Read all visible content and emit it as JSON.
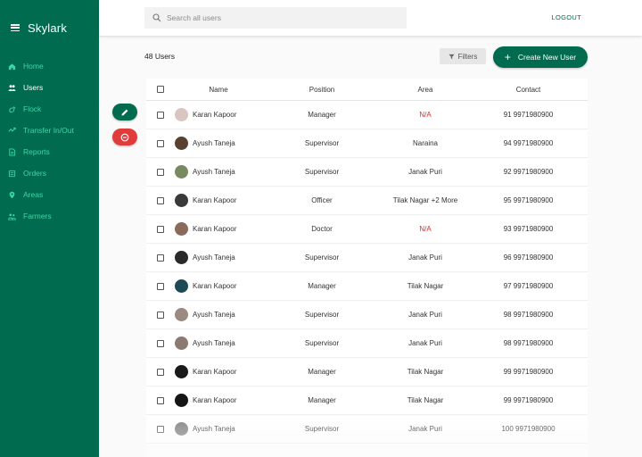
{
  "app": {
    "title": "Skylark"
  },
  "sidebar": {
    "items": [
      {
        "label": "Home",
        "icon": "home-icon",
        "active": false
      },
      {
        "label": "Users",
        "icon": "users-icon",
        "active": true
      },
      {
        "label": "Flock",
        "icon": "flock-icon",
        "active": false
      },
      {
        "label": "Transfer In/Out",
        "icon": "transfer-icon",
        "active": false
      },
      {
        "label": "Reports",
        "icon": "reports-icon",
        "active": false
      },
      {
        "label": "Orders",
        "icon": "orders-icon",
        "active": false
      },
      {
        "label": "Areas",
        "icon": "location-pin-icon",
        "active": false
      },
      {
        "label": "Farmers",
        "icon": "farmers-icon",
        "active": false
      }
    ]
  },
  "search": {
    "placeholder": "Search all users",
    "value": ""
  },
  "header": {
    "logout": "LOGOUT"
  },
  "toolbar": {
    "count": "48 Users",
    "filters": "Filters",
    "create": "Create New User"
  },
  "colors": {
    "primary": "#006b4f",
    "nav_text": "#3fd6a6",
    "danger": "#e03c3c",
    "na_text": "#d0302f"
  },
  "table": {
    "columns": {
      "name": "Name",
      "position": "Position",
      "area": "Area",
      "contact": "Contact"
    },
    "rows": [
      {
        "name": "Karan Kapoor",
        "position": "Manager",
        "area": "N/A",
        "contact": "91 9971980900",
        "avatar_color": "#d9c6c0"
      },
      {
        "name": "Ayush Taneja",
        "position": "Supervisor",
        "area": "Naraina",
        "contact": "94 9971980900",
        "avatar_color": "#5a4030"
      },
      {
        "name": "Ayush Taneja",
        "position": "Supervisor",
        "area": "Janak Puri",
        "contact": "92 9971980900",
        "avatar_color": "#7a8a60"
      },
      {
        "name": "Karan Kapoor",
        "position": "Officer",
        "area": "Tilak Nagar +2 More",
        "contact": "95 9971980900",
        "avatar_color": "#3a3a3a"
      },
      {
        "name": "Karan Kapoor",
        "position": "Doctor",
        "area": "N/A",
        "contact": "93 9971980900",
        "avatar_color": "#8a6a5a"
      },
      {
        "name": "Ayush Taneja",
        "position": "Supervisor",
        "area": "Janak Puri",
        "contact": "96 9971980900",
        "avatar_color": "#2a2a2a"
      },
      {
        "name": "Karan Kapoor",
        "position": "Manager",
        "area": "Tilak Nagar",
        "contact": "97 9971980900",
        "avatar_color": "#1f4a55"
      },
      {
        "name": "Ayush Taneja",
        "position": "Supervisor",
        "area": "Janak Puri",
        "contact": "98 9971980900",
        "avatar_color": "#9a8a80"
      },
      {
        "name": "Ayush Taneja",
        "position": "Supervisor",
        "area": "Janak Puri",
        "contact": "98 9971980900",
        "avatar_color": "#8a7a70"
      },
      {
        "name": "Karan Kapoor",
        "position": "Manager",
        "area": "Tilak Nagar",
        "contact": "99 9971980900",
        "avatar_color": "#1a1a1a"
      },
      {
        "name": "Karan Kapoor",
        "position": "Manager",
        "area": "Tilak Nagar",
        "contact": "99 9971980900",
        "avatar_color": "#151515"
      },
      {
        "name": "Ayush Taneja",
        "position": "Supervisor",
        "area": "Janak Puri",
        "contact": "100 9971980900",
        "avatar_color": "#777777"
      }
    ]
  }
}
